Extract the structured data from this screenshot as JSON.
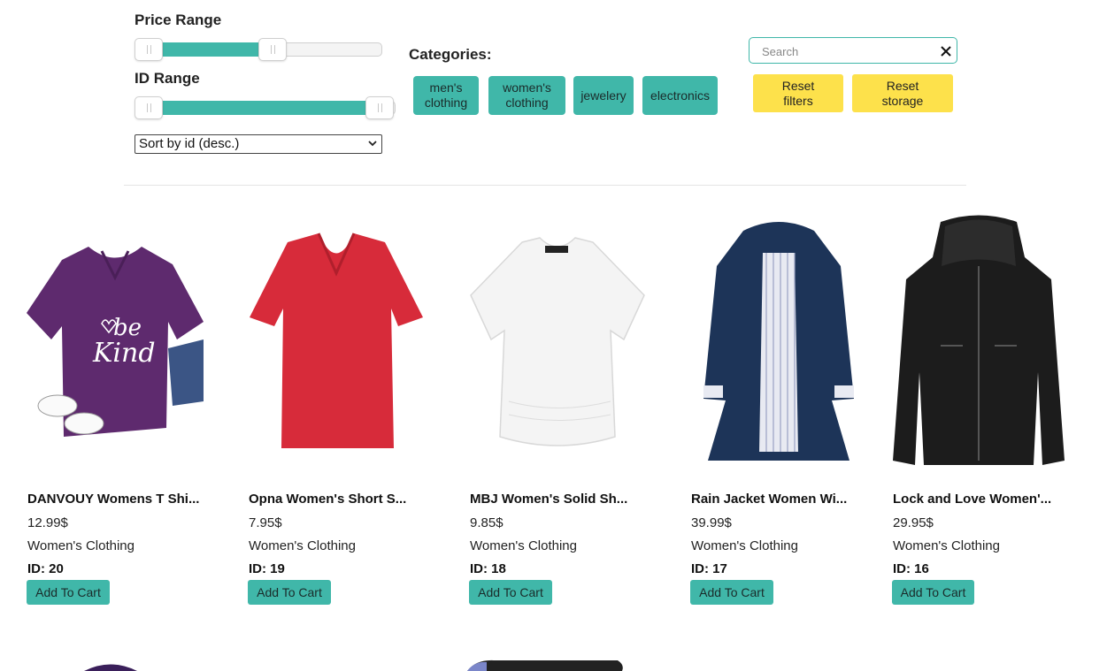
{
  "filters": {
    "price_range_label": "Price Range",
    "id_range_label": "ID Range",
    "price_range": {
      "min_fraction": 0.0,
      "max_fraction": 0.57
    },
    "id_range": {
      "min_fraction": 0.0,
      "max_fraction": 1.0
    },
    "sort": {
      "selected": "Sort by id (desc.)"
    },
    "categories_label": "Categories:",
    "categories": [
      "men's clothing",
      "women's clothing",
      "jewelery",
      "electronics"
    ],
    "search": {
      "placeholder": "Search",
      "value": ""
    },
    "reset_filters_label": "Reset filters",
    "reset_storage_label": "Reset storage"
  },
  "products": [
    {
      "title": "DANVOUY Womens T Shi...",
      "price": "12.99$",
      "category": "Women's Clothing",
      "id_text": "ID: 20",
      "button": "Add To Cart",
      "image_icon": "purple-tshirt-image",
      "color": "#5e2a6e"
    },
    {
      "title": "Opna Women's Short S...",
      "price": "7.95$",
      "category": "Women's Clothing",
      "id_text": "ID: 19",
      "button": "Add To Cart",
      "image_icon": "red-tshirt-image",
      "color": "#d72b3a"
    },
    {
      "title": "MBJ Women's Solid Sh...",
      "price": "9.85$",
      "category": "Women's Clothing",
      "id_text": "ID: 18",
      "button": "Add To Cart",
      "image_icon": "white-top-image",
      "color": "#f2f2f2"
    },
    {
      "title": "Rain Jacket Women Wi...",
      "price": "39.99$",
      "category": "Women's Clothing",
      "id_text": "ID: 17",
      "button": "Add To Cart",
      "image_icon": "navy-jacket-image",
      "color": "#1d3458"
    },
    {
      "title": "Lock and Love Women'...",
      "price": "29.95$",
      "category": "Women's Clothing",
      "id_text": "ID: 16",
      "button": "Add To Cart",
      "image_icon": "black-leather-jacket-image",
      "color": "#1c1c1c"
    }
  ],
  "accent_color": "#40b7a9",
  "reset_color": "#fde14b"
}
